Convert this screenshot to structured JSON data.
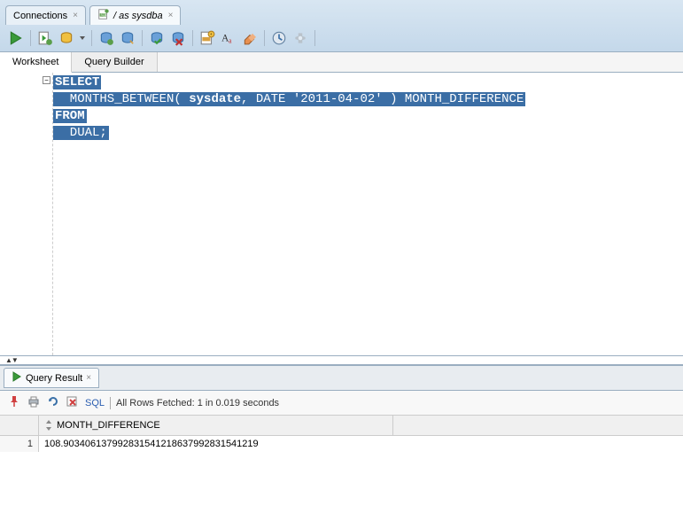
{
  "tabs": [
    {
      "label": "Connections",
      "icon": "conn"
    },
    {
      "label": "/ as sysdba",
      "icon": "sql"
    }
  ],
  "ws_tabs": {
    "worksheet": "Worksheet",
    "query_builder": "Query Builder"
  },
  "sql": {
    "l1a": "SELECT",
    "l2": "  MONTHS_BETWEEN( ",
    "l2b": "sysdate",
    "l2c": ", DATE '2011-04-02' ) MONTH_DIFFERENCE",
    "l3": "FROM",
    "l4": "  DUAL;"
  },
  "result": {
    "tab_label": "Query Result",
    "sql_label": "SQL",
    "status": "All Rows Fetched: 1 in 0.019 seconds",
    "column": "MONTH_DIFFERENCE",
    "rownum": "1",
    "value": "108.903406137992831541218637992831541219"
  }
}
